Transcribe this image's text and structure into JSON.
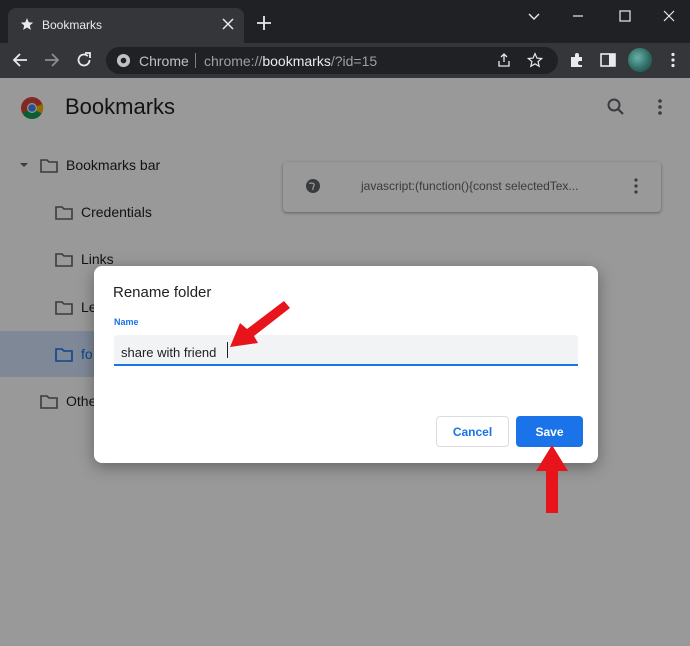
{
  "browser": {
    "tab_title": "Bookmarks",
    "omnibox": {
      "site_chip": "Chrome",
      "url_prefix": "chrome://",
      "url_host": "bookmarks",
      "url_suffix": "/?id=15"
    }
  },
  "page": {
    "title": "Bookmarks",
    "tree": {
      "root": "Bookmarks bar",
      "children": [
        "Credentials",
        "Links",
        "Le",
        "fo"
      ],
      "other": "Othe"
    },
    "bookmark_item": {
      "text": "javascript:(function(){const selectedTex..."
    }
  },
  "dialog": {
    "title": "Rename folder",
    "field_label": "Name",
    "field_value": "share with friend",
    "cancel_label": "Cancel",
    "save_label": "Save"
  },
  "colors": {
    "accent": "#1a73e8",
    "annotation_arrow": "#e8141c"
  }
}
